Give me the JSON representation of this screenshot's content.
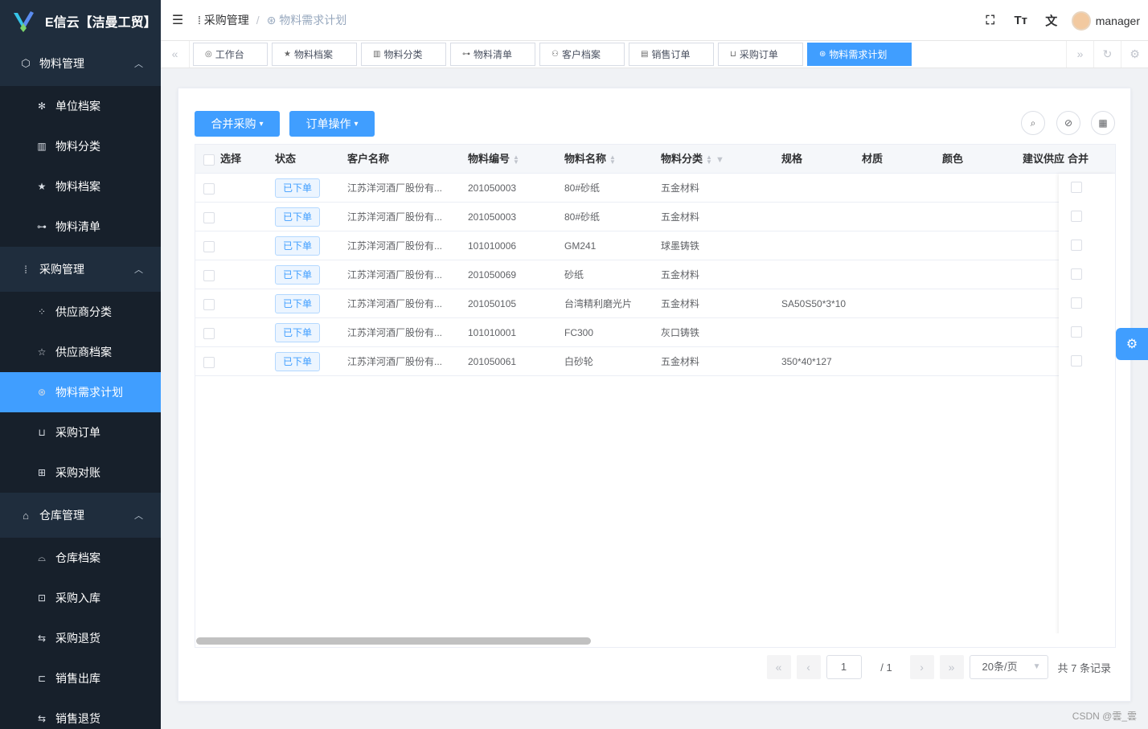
{
  "app": {
    "logo_text": "E信云【洁曼工贸】"
  },
  "sidebar": {
    "groups": [
      {
        "label": "物料管理",
        "icon": "cube-icon",
        "items": [
          {
            "label": "单位档案",
            "icon": "snowflake-icon"
          },
          {
            "label": "物料分类",
            "icon": "grid-icon"
          },
          {
            "label": "物料档案",
            "icon": "star-icon"
          },
          {
            "label": "物料清单",
            "icon": "tree-icon"
          }
        ]
      },
      {
        "label": "采购管理",
        "icon": "purchase-icon",
        "items": [
          {
            "label": "供应商分类",
            "icon": "apps-icon"
          },
          {
            "label": "供应商档案",
            "icon": "star-outline-icon"
          },
          {
            "label": "物料需求计划",
            "icon": "aperture-icon",
            "active": true
          },
          {
            "label": "采购订单",
            "icon": "order-icon"
          },
          {
            "label": "采购对账",
            "icon": "reconcile-icon"
          }
        ]
      },
      {
        "label": "仓库管理",
        "icon": "warehouse-icon",
        "items": [
          {
            "label": "仓库档案",
            "icon": "store-icon"
          },
          {
            "label": "采购入库",
            "icon": "inbox-icon"
          },
          {
            "label": "采购退货",
            "icon": "return-icon"
          },
          {
            "label": "销售出库",
            "icon": "outbound-icon"
          },
          {
            "label": "销售退货",
            "icon": "return-icon"
          }
        ]
      }
    ]
  },
  "header": {
    "breadcrumb": [
      "采购管理",
      "物料需求计划"
    ],
    "username": "manager"
  },
  "tags": [
    {
      "label": "工作台",
      "icon": "dashboard-icon"
    },
    {
      "label": "物料档案",
      "icon": "star-icon"
    },
    {
      "label": "物料分类",
      "icon": "grid-icon"
    },
    {
      "label": "物料清单",
      "icon": "tree-icon"
    },
    {
      "label": "客户档案",
      "icon": "customer-icon"
    },
    {
      "label": "销售订单",
      "icon": "sales-icon"
    },
    {
      "label": "采购订单",
      "icon": "order-icon"
    },
    {
      "label": "物料需求计划",
      "icon": "aperture-icon",
      "active": true
    }
  ],
  "toolbar": {
    "merge_label": "合并采购",
    "order_label": "订单操作"
  },
  "table": {
    "columns": [
      "选择",
      "状态",
      "客户名称",
      "物料编号",
      "物料名称",
      "物料分类",
      "规格",
      "材质",
      "颜色",
      "建议供应",
      "合并"
    ],
    "rows": [
      {
        "status": "已下单",
        "customer": "江苏洋河酒厂股份有...",
        "code": "201050003",
        "name": "80#砂纸",
        "category": "五金材料",
        "spec": ""
      },
      {
        "status": "已下单",
        "customer": "江苏洋河酒厂股份有...",
        "code": "201050003",
        "name": "80#砂纸",
        "category": "五金材料",
        "spec": ""
      },
      {
        "status": "已下单",
        "customer": "江苏洋河酒厂股份有...",
        "code": "101010006",
        "name": "GM241",
        "category": "球墨铸铁",
        "spec": ""
      },
      {
        "status": "已下单",
        "customer": "江苏洋河酒厂股份有...",
        "code": "201050069",
        "name": "砂纸",
        "category": "五金材料",
        "spec": ""
      },
      {
        "status": "已下单",
        "customer": "江苏洋河酒厂股份有...",
        "code": "201050105",
        "name": "台湾精利磨光片",
        "category": "五金材料",
        "spec": "SA50S50*3*10"
      },
      {
        "status": "已下单",
        "customer": "江苏洋河酒厂股份有...",
        "code": "101010001",
        "name": "FC300",
        "category": "灰口铸铁",
        "spec": ""
      },
      {
        "status": "已下单",
        "customer": "江苏洋河酒厂股份有...",
        "code": "201050061",
        "name": "白砂轮",
        "category": "五金材料",
        "spec": "350*40*127"
      }
    ]
  },
  "pager": {
    "page": "1",
    "total_pages": "/ 1",
    "page_size": "20条/页",
    "total": "共 7 条记录"
  },
  "watermark": "CSDN @雲_雲",
  "colors": {
    "primary": "#409eff",
    "sidebar": "#1f2d3d"
  }
}
